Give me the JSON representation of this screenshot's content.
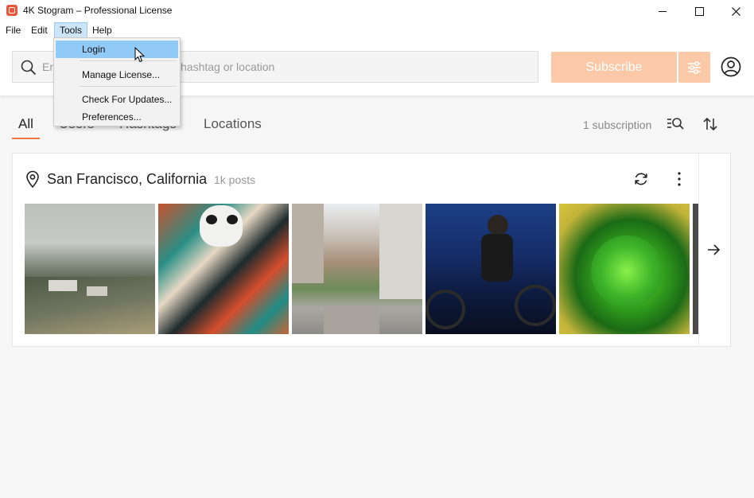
{
  "window": {
    "title": "4K Stogram – Professional License",
    "controls": [
      "minimize",
      "maximize",
      "close"
    ]
  },
  "menubar": {
    "items": [
      "File",
      "Edit",
      "Tools",
      "Help"
    ]
  },
  "tools_menu": {
    "items": [
      "Login",
      "Manage License...",
      "Check For Updates...",
      "Preferences..."
    ],
    "highlighted": "Login"
  },
  "search": {
    "visible_prefix": "En",
    "visible_suffix": "hashtag or location"
  },
  "header": {
    "subscribe_label": "Subscribe",
    "accent": "#fcc9a8"
  },
  "tabs": {
    "items": [
      "All",
      "Users",
      "Hashtags",
      "Locations"
    ],
    "active": "All",
    "active_color": "#f07a3a"
  },
  "subscriptions": {
    "count_label": "1 subscription"
  },
  "card": {
    "location": "San Francisco, California",
    "posts": "1k posts",
    "thumbnails": [
      "foggy-hillside-houses",
      "dog-in-striped-blanket",
      "city-street-cable-car",
      "cyclist-at-night",
      "green-succulent"
    ]
  },
  "icons": [
    "search-icon",
    "filter-sliders-icon",
    "account-icon",
    "list-search-icon",
    "sort-icon",
    "location-pin-icon",
    "refresh-icon",
    "more-vertical-icon",
    "arrow-right-icon"
  ]
}
